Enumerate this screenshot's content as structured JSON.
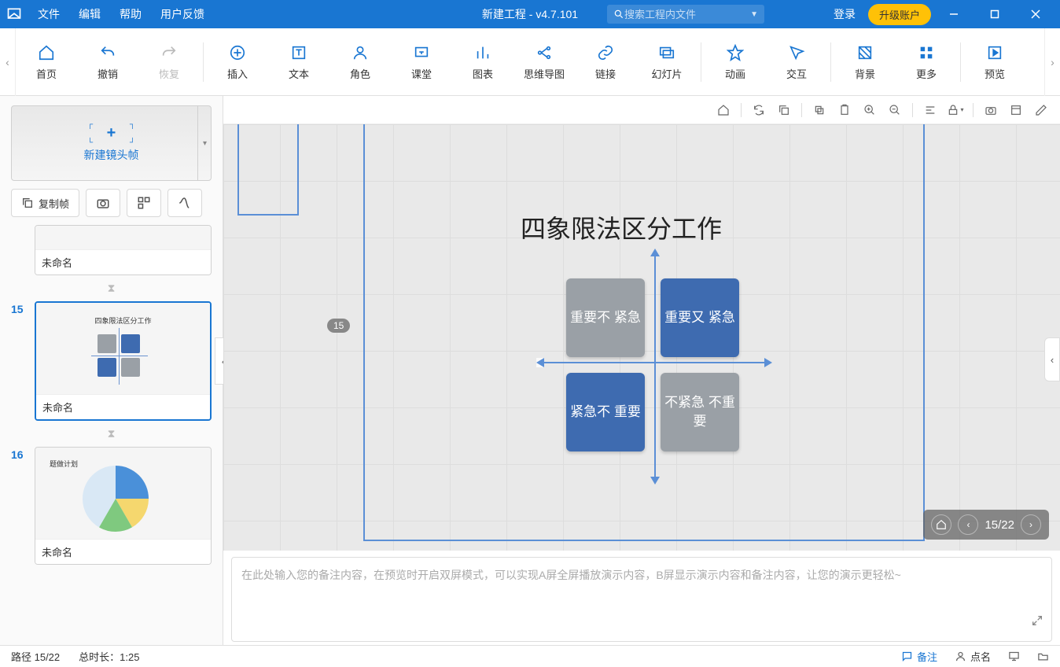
{
  "titlebar": {
    "menus": {
      "file": "文件",
      "edit": "编辑",
      "help": "帮助",
      "feedback": "用户反馈"
    },
    "title": "新建工程 - v4.7.101",
    "search_placeholder": "搜索工程内文件",
    "login": "登录",
    "upgrade": "升级账户"
  },
  "ribbon": {
    "home": "首页",
    "undo": "撤销",
    "redo": "恢复",
    "insert": "插入",
    "text": "文本",
    "role": "角色",
    "class": "课堂",
    "chart": "图表",
    "mindmap": "思维导图",
    "link": "链接",
    "slides": "幻灯片",
    "anim": "动画",
    "interact": "交互",
    "bg": "背景",
    "more": "更多",
    "preview": "预览"
  },
  "left": {
    "new_frame": "新建镜头帧",
    "copy_frame": "复制帧",
    "thumbs": {
      "prev": {
        "caption": "未命名"
      },
      "current": {
        "num": "15",
        "caption": "未命名"
      },
      "next": {
        "num": "16",
        "caption": "未命名"
      }
    }
  },
  "canvas": {
    "badge": "15",
    "slide_title": "四象限法区分工作",
    "quad": {
      "q1": "重要不\n紧急",
      "q2": "重要又\n紧急",
      "q3": "紧急不\n重要",
      "q4": "不紧急\n不重要"
    },
    "pager": "15/22"
  },
  "notes": {
    "placeholder": "在此处输入您的备注内容，在预览时开启双屏模式，可以实现A屏全屏播放演示内容，B屏显示演示内容和备注内容，让您的演示更轻松~"
  },
  "status": {
    "path": "路径 15/22",
    "duration": "总时长：1:25",
    "remark": "备注",
    "roll": "点名",
    "present": "",
    "cloud": ""
  },
  "mini": {
    "title": "四象限法区分工作",
    "next_title": "题做计划"
  }
}
